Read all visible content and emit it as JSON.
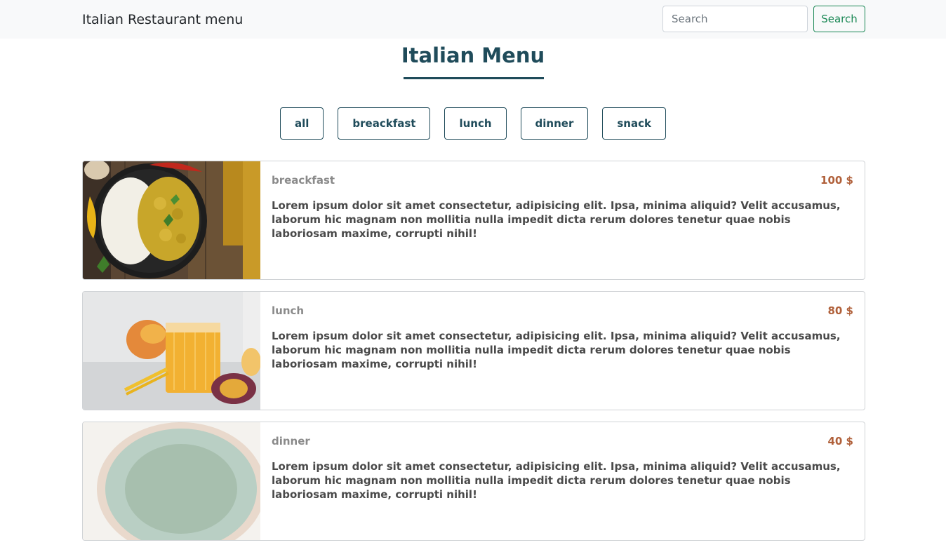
{
  "navbar": {
    "brand": "Italian Restaurant menu",
    "search_placeholder": "Search",
    "search_button": "Search"
  },
  "page": {
    "title": "Italian Menu"
  },
  "filters": [
    "all",
    "breackfast",
    "lunch",
    "dinner",
    "snack"
  ],
  "menu": [
    {
      "category": "breackfast",
      "price": "100 $",
      "description": "Lorem ipsum dolor sit amet consectetur, adipisicing elit. Ipsa, minima aliquid? Velit accusamus, laborum hic magnam non mollitia nulla impedit dicta rerum dolores tenetur quae nobis laboriosam maxime, corrupti nihil!",
      "image": "curry-rice-bowl-photo"
    },
    {
      "category": "lunch",
      "price": "80 $",
      "description": "Lorem ipsum dolor sit amet consectetur, adipisicing elit. Ipsa, minima aliquid? Velit accusamus, laborum hic magnam non mollitia nulla impedit dicta rerum dolores tenetur quae nobis laboriosam maxime, corrupti nihil!",
      "image": "mango-juice-glass-photo"
    },
    {
      "category": "dinner",
      "price": "40 $",
      "description": "Lorem ipsum dolor sit amet consectetur, adipisicing elit. Ipsa, minima aliquid? Velit accusamus, laborum hic magnam non mollitia nulla impedit dicta rerum dolores tenetur quae nobis laboriosam maxime, corrupti nihil!",
      "image": "salad-plate-photo"
    }
  ],
  "colors": {
    "accent": "#1f4b5a",
    "success": "#198754",
    "price": "#b0603a",
    "navbar_bg": "#f8f9fa"
  }
}
